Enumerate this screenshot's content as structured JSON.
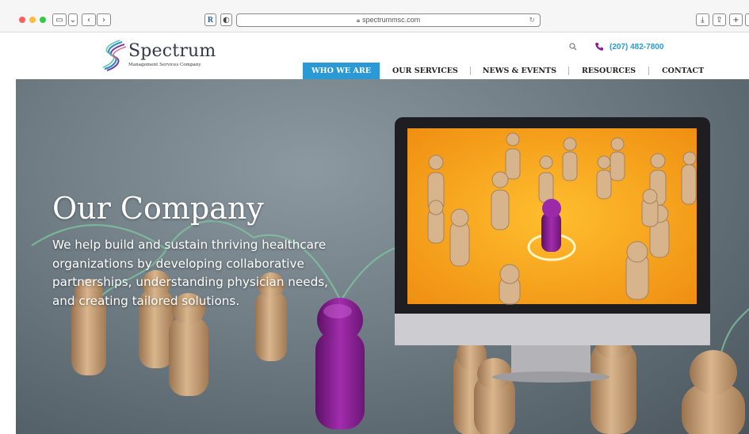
{
  "browser": {
    "url": "spectrummsc.com",
    "reader_label": "R",
    "shield_label": "◐",
    "new_tab": "+",
    "back": "‹",
    "forward": "›",
    "sidebar": "▭",
    "chevron": "⌄",
    "download": "⤓",
    "share": "⇪"
  },
  "header": {
    "logo_name": "Spectrum",
    "logo_tagline": "Management Services Company",
    "phone": "(207) 482-7800"
  },
  "nav": {
    "items": [
      {
        "label": "WHO WE ARE",
        "active": true
      },
      {
        "label": "OUR SERVICES",
        "active": false
      },
      {
        "label": "NEWS & EVENTS",
        "active": false
      },
      {
        "label": "RESOURCES",
        "active": false
      },
      {
        "label": "CONTACT",
        "active": false
      }
    ]
  },
  "hero": {
    "title": "Our Company",
    "body": "We help build and sustain thriving healthcare organizations by developing collaborative partnerships, understanding physician needs, and creating tailored solutions."
  },
  "colors": {
    "accent": "#2b9ad4",
    "purple": "#8a1f92",
    "text_dark": "#333a4a"
  },
  "icons": [
    "search-icon",
    "phone-icon",
    "lock-icon",
    "reload-icon",
    "logo-swirl-icon"
  ]
}
